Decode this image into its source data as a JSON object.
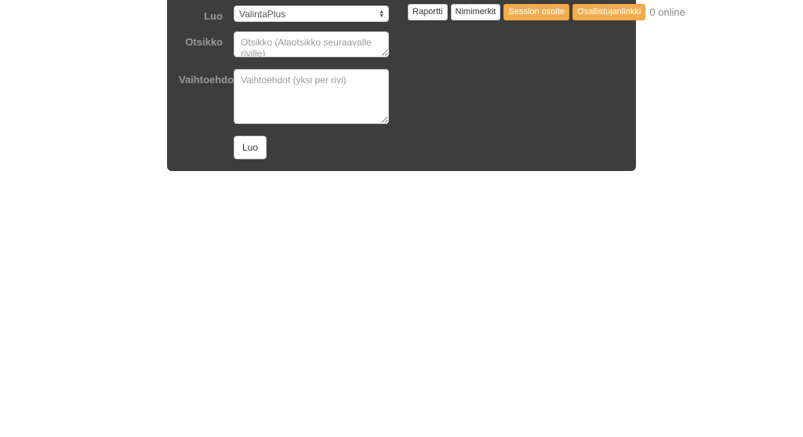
{
  "form": {
    "luo_label": "Luo",
    "select_value": "ValintaPlus",
    "otsikko_label": "Otsikko",
    "otsikko_placeholder": "Otsikko (Alaotsikko seuraavalle riville)",
    "vaihtoehdot_label": "Vaihtoehdot",
    "vaihtoehdot_placeholder": "Vaihtoehdot (yksi per rivi)",
    "submit_label": "Luo"
  },
  "sidebar": {
    "raportti": "Raportti",
    "nimimerkit": "Nimimerkit",
    "session_osoite": "Session osoite",
    "osallistujanlinkki": "Osallistujanlinkki",
    "online_text": "0 online"
  }
}
